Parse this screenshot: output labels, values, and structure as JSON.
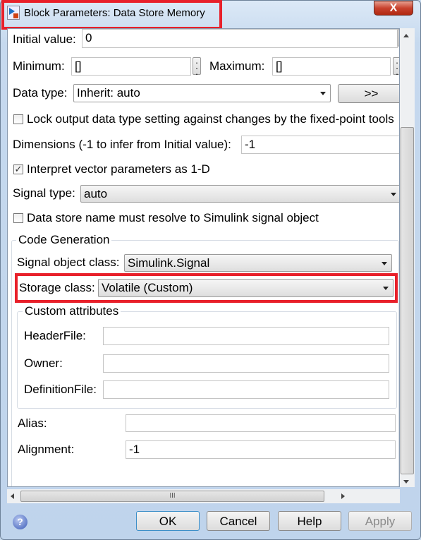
{
  "window": {
    "title": "Block Parameters: Data Store Memory",
    "close_label": "X"
  },
  "fields": {
    "initial_value": {
      "label": "Initial value:",
      "value": "0"
    },
    "minimum": {
      "label": "Minimum:",
      "value": "[]"
    },
    "maximum": {
      "label": "Maximum:",
      "value": "[]"
    },
    "data_type": {
      "label": "Data type:",
      "value": "Inherit: auto",
      "button": ">>"
    },
    "lock_output": {
      "label": "Lock output data type setting against changes by the fixed-point tools",
      "checked": false
    },
    "dimensions": {
      "label": "Dimensions (-1 to infer from Initial value):",
      "value": "-1"
    },
    "interpret_vector": {
      "label": "Interpret vector parameters as 1-D",
      "checked": true
    },
    "signal_type": {
      "label": "Signal type:",
      "value": "auto"
    },
    "must_resolve": {
      "label": "Data store name must resolve to Simulink signal object",
      "checked": false
    }
  },
  "code_generation": {
    "title": "Code Generation",
    "signal_object_class": {
      "label": "Signal object class:",
      "value": "Simulink.Signal"
    },
    "storage_class": {
      "label": "Storage class:",
      "value": "Volatile (Custom)"
    },
    "custom_attributes": {
      "title": "Custom attributes",
      "header_file": {
        "label": "HeaderFile:",
        "value": ""
      },
      "owner": {
        "label": "Owner:",
        "value": ""
      },
      "definition_file": {
        "label": "DefinitionFile:",
        "value": ""
      }
    },
    "alias": {
      "label": "Alias:",
      "value": ""
    },
    "alignment": {
      "label": "Alignment:",
      "value": "-1"
    }
  },
  "footer": {
    "ok": "OK",
    "cancel": "Cancel",
    "help": "Help",
    "apply": "Apply",
    "help_icon": "?"
  },
  "colors": {
    "highlight": "#e8202a"
  }
}
